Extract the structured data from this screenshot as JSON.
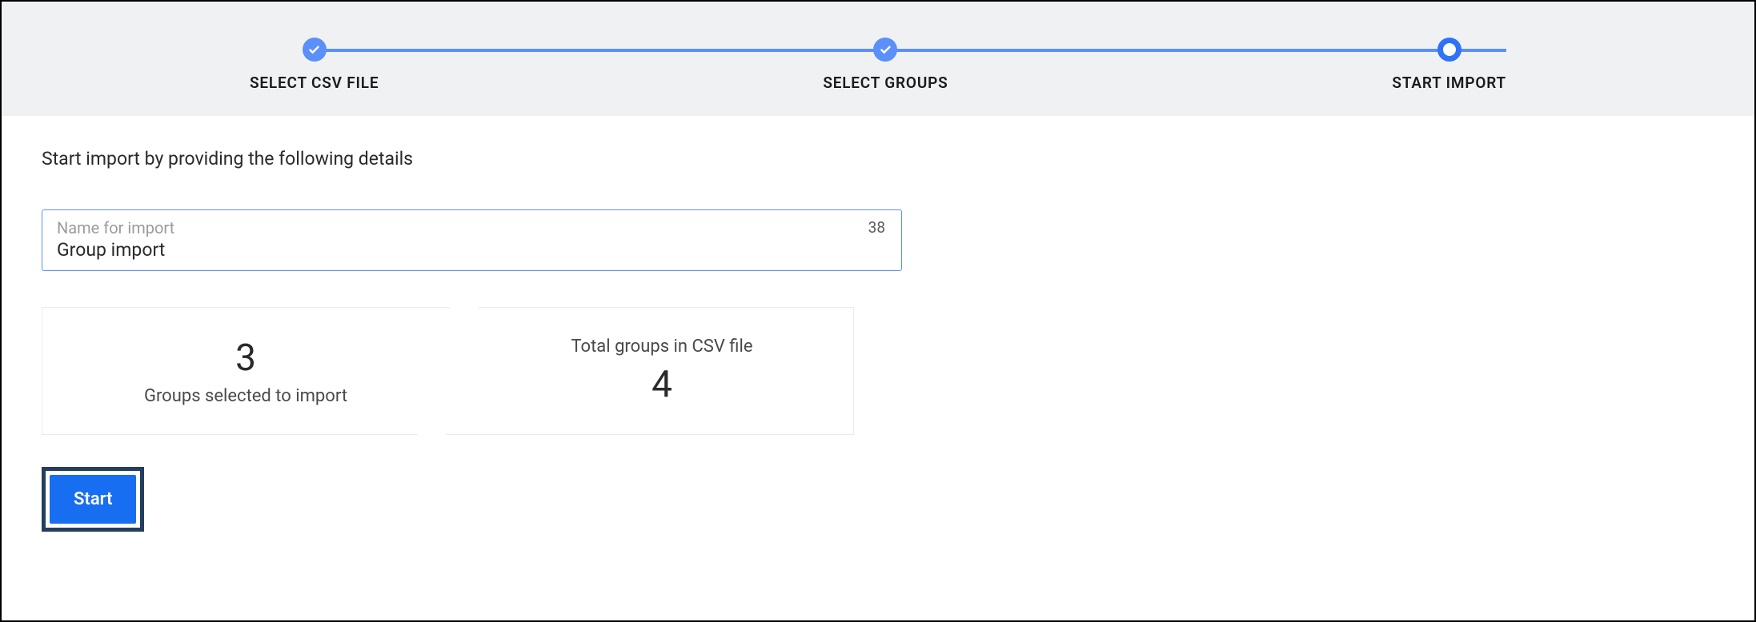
{
  "stepper": {
    "steps": [
      {
        "label": "SELECT CSV FILE",
        "state": "completed"
      },
      {
        "label": "SELECT GROUPS",
        "state": "completed"
      },
      {
        "label": "START IMPORT",
        "state": "current"
      }
    ]
  },
  "content": {
    "instruction": "Start import by providing the following details",
    "name_input": {
      "label": "Name for import",
      "value": "Group import",
      "counter": "38"
    },
    "stats": {
      "selected": {
        "value": "3",
        "label": "Groups selected to import"
      },
      "total": {
        "value": "4",
        "label": "Total groups in CSV file"
      }
    },
    "start_button": "Start"
  }
}
